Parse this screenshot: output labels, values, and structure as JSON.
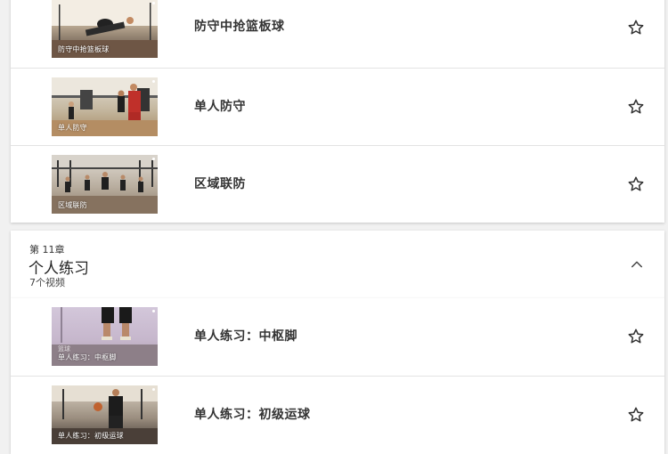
{
  "group_one": {
    "videos": [
      {
        "title": "防守中抢篮板球",
        "thumb_caption": "防守中抢篮板球",
        "thumb_colors": [
          "#d8cdbc",
          "#5b4a3c"
        ]
      },
      {
        "title": "单人防守",
        "thumb_caption": "单人防守",
        "thumb_colors": [
          "#c9b08a",
          "#3a2e26"
        ]
      },
      {
        "title": "区域联防",
        "thumb_caption": "区域联防",
        "thumb_colors": [
          "#bfb7ad",
          "#6b5d52"
        ]
      }
    ]
  },
  "chapter": {
    "number_label": "第 11章",
    "title": "个人练习",
    "count_label": "7个视频",
    "toggle_icon": "chevron-up-icon"
  },
  "group_two": {
    "videos": [
      {
        "title": "单人练习：中枢脚",
        "thumb_caption": "单人练习：中枢脚",
        "thumb_sub": "篮球",
        "thumb_colors": [
          "#c7b7cf",
          "#6a5f63"
        ]
      },
      {
        "title": "单人练习：初级运球",
        "thumb_caption": "单人练习：初级运球",
        "thumb_colors": [
          "#a79a8c",
          "#2f2a27"
        ]
      }
    ]
  },
  "icons": {
    "favorite": "star-outline-icon"
  },
  "colors": {
    "background": "#f1f1f1",
    "card": "#ffffff",
    "divider": "#e3e3e3"
  }
}
